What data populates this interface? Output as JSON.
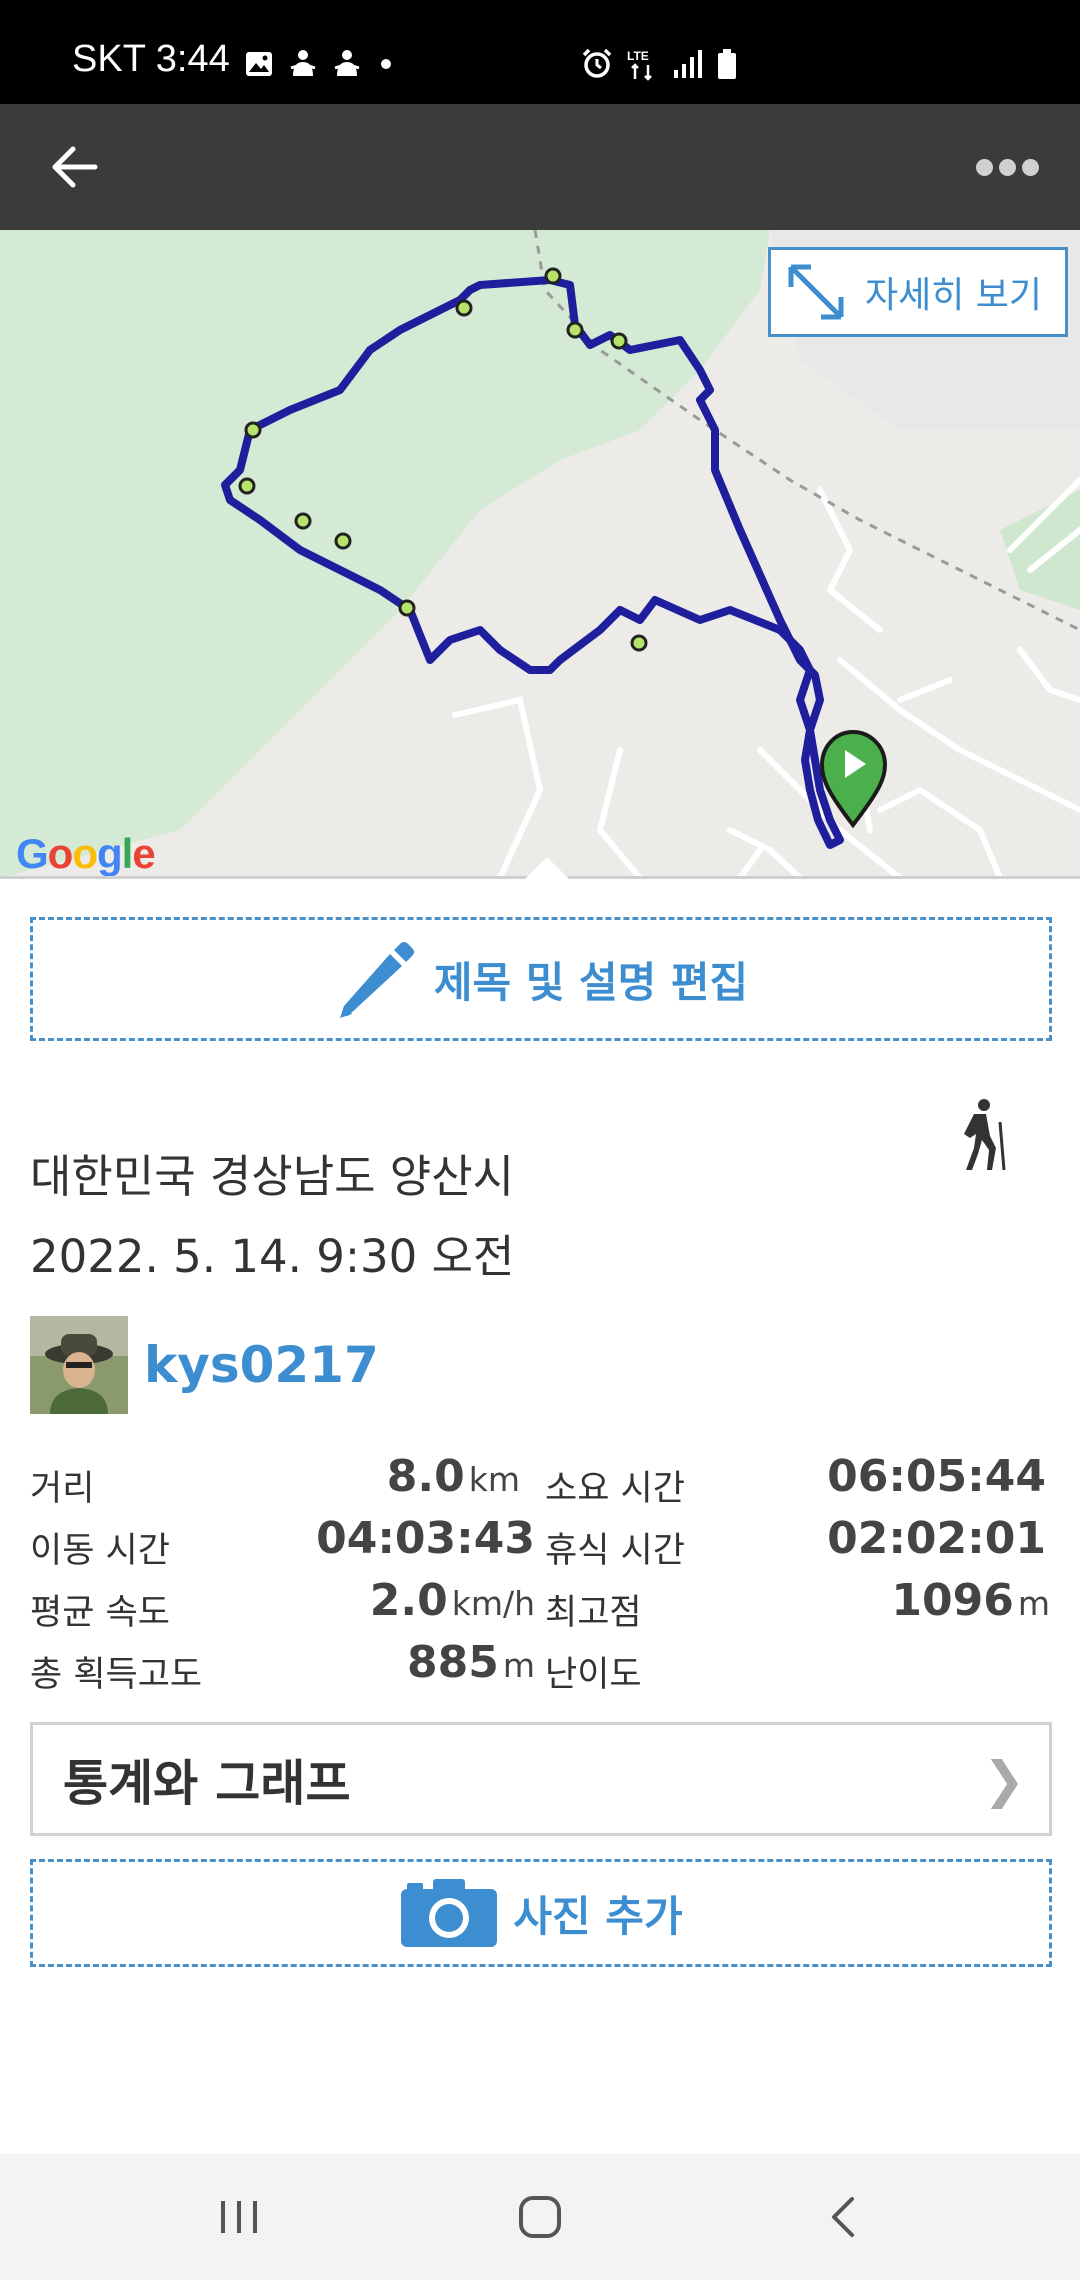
{
  "status_bar": {
    "carrier_time": "SKT 3:44",
    "left_icons": [
      "image-icon",
      "app-notification-icon",
      "app-notification-icon",
      "dot-icon"
    ],
    "right_icons": [
      "alarm-icon",
      "lte-icon",
      "signal-icon",
      "battery-icon"
    ],
    "network": "LTE"
  },
  "app_bar": {
    "back_icon": "arrow-left-icon",
    "more_icon": "more-dots-icon"
  },
  "map": {
    "detail_button_label": "자세히 보기",
    "attribution": "Google",
    "route_color": "#1f1f9e",
    "start_marker_color": "#4bb04b"
  },
  "edit_button_label": "제목 및 설명 편집",
  "location": "대한민국 경상남도 양산시",
  "datetime": "2022. 5. 14. 9:30 오전",
  "activity_icon": "hiking-icon",
  "user": {
    "username": "kys0217"
  },
  "stats": {
    "distance": {
      "label": "거리",
      "value": "8.0",
      "unit": "km"
    },
    "total_time": {
      "label": "소요 시간",
      "value": "06:05:44"
    },
    "moving_time": {
      "label": "이동 시간",
      "value": "04:03:43"
    },
    "rest_time": {
      "label": "휴식 시간",
      "value": "02:02:01"
    },
    "avg_speed": {
      "label": "평균 속도",
      "value": "2.0",
      "unit": "km/h"
    },
    "max_elevation": {
      "label": "최고점",
      "value": "1096",
      "unit": "m"
    },
    "total_ascent": {
      "label": "총 획득고도",
      "value": "885",
      "unit": "m"
    },
    "difficulty": {
      "label": "난이도",
      "value": ""
    }
  },
  "graph_button_label": "통계와 그래프",
  "add_photo_label": "사진 추가",
  "nav": {
    "items": [
      "recents-icon",
      "home-icon",
      "back-icon"
    ]
  },
  "colors": {
    "accent": "#3d8ed0",
    "app_bar": "#3b3b3b",
    "status_bar": "#000000"
  }
}
